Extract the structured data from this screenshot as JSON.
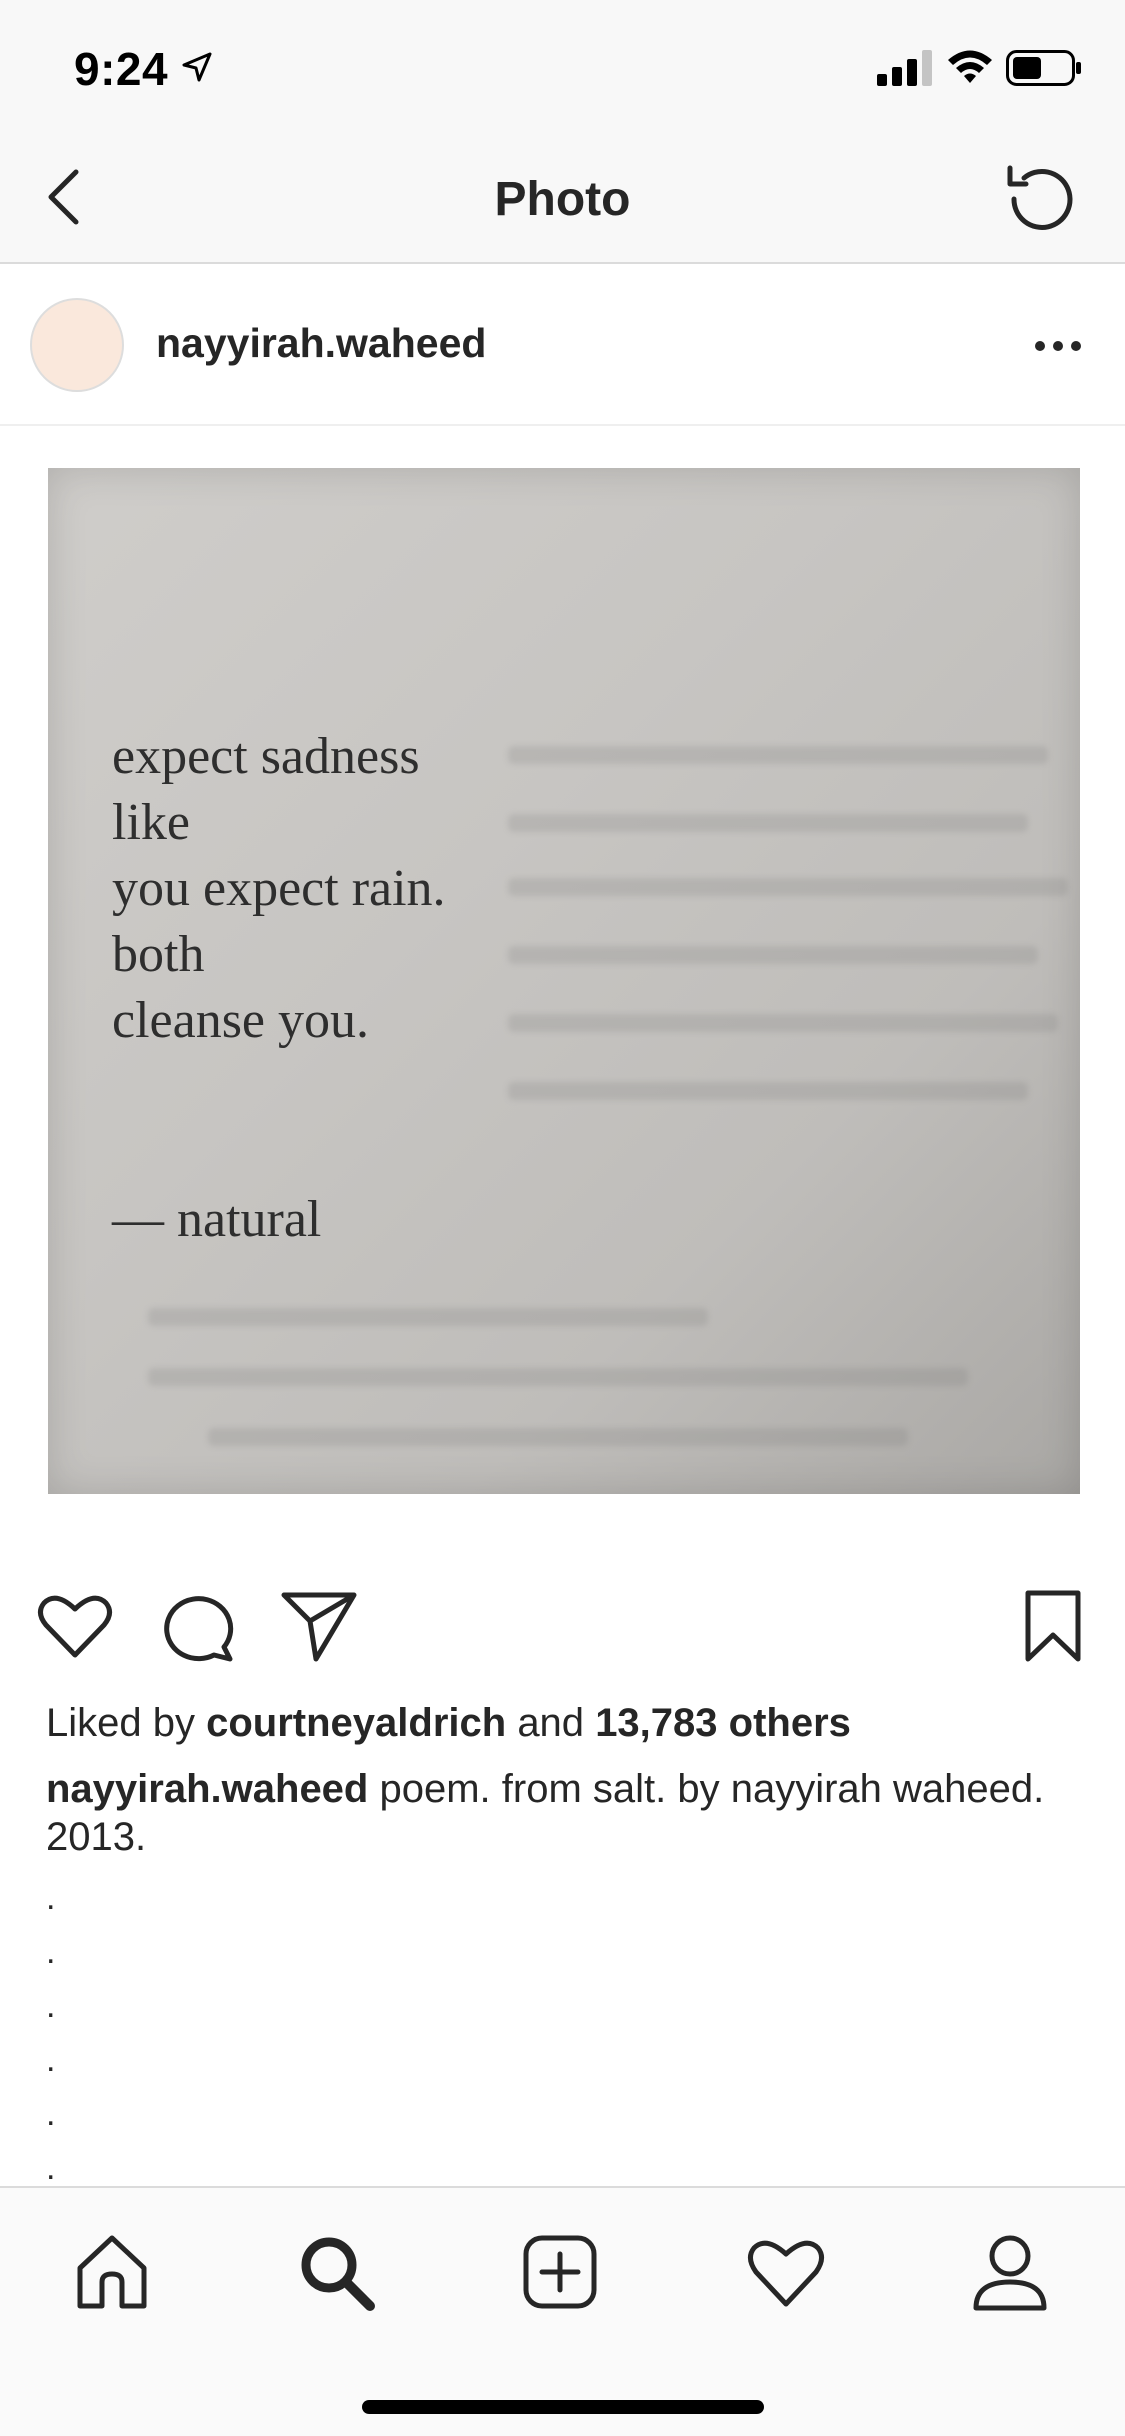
{
  "status_bar": {
    "time": "9:24"
  },
  "nav": {
    "title": "Photo"
  },
  "post": {
    "username": "nayyirah.waheed",
    "image_text": {
      "lines": [
        "expect sadness",
        "like",
        "you expect rain.",
        "both",
        "cleanse you."
      ],
      "credit": "— natural"
    }
  },
  "likes": {
    "prefix": "Liked by",
    "user": "courtneyaldrich",
    "middle": "and",
    "others": "13,783 others"
  },
  "caption": {
    "username": "nayyirah.waheed",
    "text": "poem. from salt. by nayyirah waheed. 2013."
  },
  "caption_dots": [
    ".",
    ".",
    ".",
    ".",
    ".",
    "."
  ],
  "icons": {
    "back": "chevron-left-icon",
    "refresh": "refresh-icon",
    "more": "more-icon",
    "like": "heart-icon",
    "comment": "comment-icon",
    "share": "paper-plane-icon",
    "save": "bookmark-icon",
    "home": "home-icon",
    "search": "search-icon",
    "add": "add-post-icon",
    "activity": "heart-icon",
    "profile": "profile-icon"
  },
  "colors": {
    "text": "#262626",
    "background": "#fafafa",
    "avatar": "#fae8dc"
  }
}
